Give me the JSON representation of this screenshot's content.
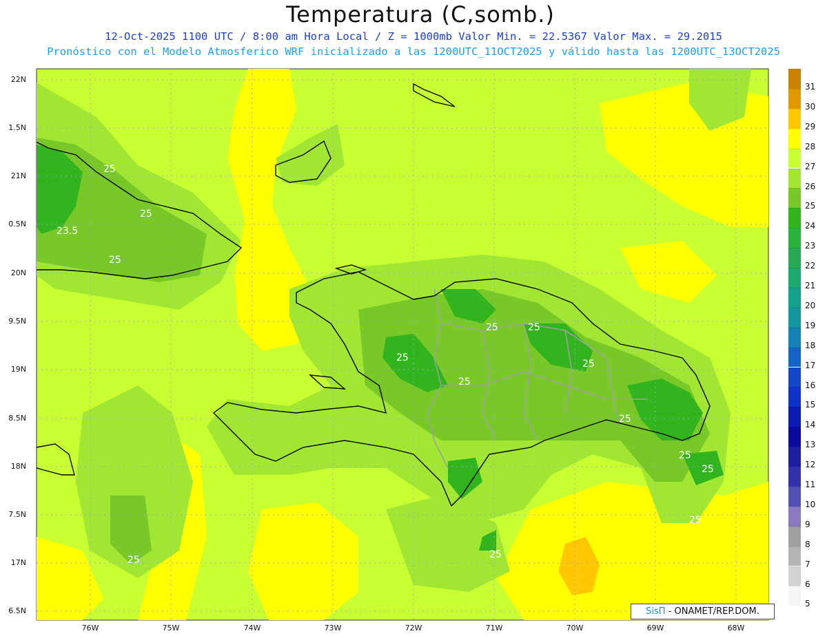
{
  "title": "Temperatura (C,somb.)",
  "subtitle_line1": "12-Oct-2025  1100 UTC / 8:00 am Hora Local / Z = 1000mb   Valor Min. = 22.5367  Valor Max. = 29.2015",
  "subtitle_line2": "Pronóstico con el Modelo Atmosferico WRF inicializado a las 1200UTC_11OCT2025 y válido hasta las  1200UTC_13OCT2025",
  "credit": {
    "brand": "SisΠ",
    "text": " - ONAMET/REP.DOM."
  },
  "lat_labels": [
    "22N",
    "1.5N",
    "21N",
    "0.5N",
    "20N",
    "9.5N",
    "19N",
    "8.5N",
    "18N",
    "7.5N",
    "17N",
    "6.5N"
  ],
  "lon_labels": [
    "76W",
    "75W",
    "74W",
    "73W",
    "72W",
    "71W",
    "70W",
    "69W",
    "68W"
  ],
  "contour_labels": [
    "25",
    "25",
    "23.5",
    "25",
    "25",
    "25",
    "25",
    "25",
    "25",
    "25",
    "25",
    "25",
    "25",
    "25",
    "25"
  ],
  "colorbar": {
    "levels": [
      "31",
      "30",
      "29",
      "28",
      "27",
      "26",
      "25",
      "24",
      "23",
      "22",
      "21",
      "20",
      "19",
      "18",
      "17",
      "16",
      "15",
      "14",
      "13",
      "12",
      "11",
      "10",
      "9",
      "8",
      "7",
      "6",
      "5"
    ],
    "colors": [
      "#c88200",
      "#e09a00",
      "#ffc800",
      "#ffff00",
      "#c8ff32",
      "#a0e632",
      "#78c828",
      "#32b41e",
      "#28b43c",
      "#28aa55",
      "#1eaa6e",
      "#14a08c",
      "#1496a0",
      "#1482b4",
      "#1464c8",
      "#1446c8",
      "#0f32c8",
      "#0a1eb4",
      "#0a0aa0",
      "#1e1ea0",
      "#3232aa",
      "#5050b4",
      "#8c78be",
      "#a0a0a0",
      "#b4b4b4",
      "#d2d2d2",
      "#f5f5f5"
    ]
  },
  "colors": {
    "land_dark": "#32b41e",
    "land_mid": "#78c828",
    "land_light": "#a0e632",
    "background": "#c8ff32",
    "warm": "#ffff00",
    "hot": "#ffc800",
    "coast": "#000000",
    "borders": "#a0a0a0",
    "grid": "#9aa0e6"
  }
}
